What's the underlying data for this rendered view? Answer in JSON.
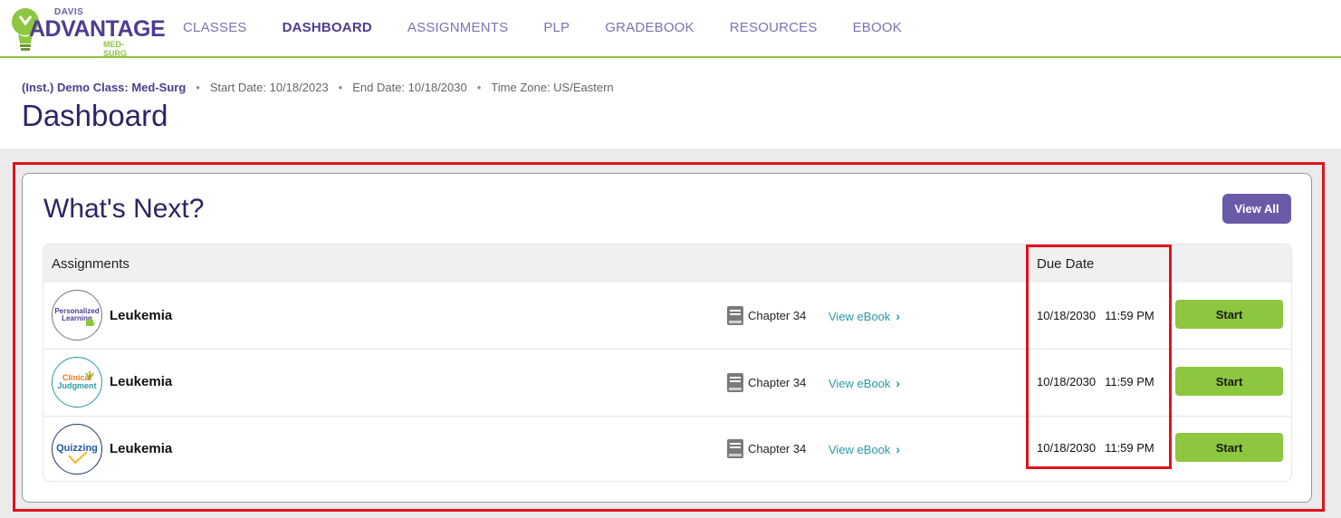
{
  "brand": {
    "line1": "DAVIS",
    "line2": "ADVANTAGE",
    "line3": "MED-SURG"
  },
  "nav": [
    {
      "label": "CLASSES",
      "active": false
    },
    {
      "label": "DASHBOARD",
      "active": true
    },
    {
      "label": "ASSIGNMENTS",
      "active": false
    },
    {
      "label": "PLP",
      "active": false
    },
    {
      "label": "GRADEBOOK",
      "active": false
    },
    {
      "label": "RESOURCES",
      "active": false
    },
    {
      "label": "EBOOK",
      "active": false
    }
  ],
  "meta": {
    "class_name": "(Inst.) Demo Class: Med-Surg",
    "start_date": "Start Date: 10/18/2023",
    "end_date": "End Date: 10/18/2030",
    "time_zone": "Time Zone: US/Eastern",
    "separator": "•"
  },
  "page_title": "Dashboard",
  "whats_next": {
    "title": "What's Next?",
    "view_all_label": "View All",
    "columns": {
      "assignments": "Assignments",
      "due_date": "Due Date"
    },
    "rows": [
      {
        "badge": [
          "Personalized",
          "Learning"
        ],
        "badge_icon": "puzzle-icon",
        "name": "Leukemia",
        "chapter": "Chapter 34",
        "ebook_label": "View eBook",
        "date": "10/18/2030",
        "time": "11:59 PM",
        "action": "Start"
      },
      {
        "badge": [
          "Clinical",
          "Judgment"
        ],
        "badge_icon": "scale-icon",
        "name": "Leukemia",
        "chapter": "Chapter 34",
        "ebook_label": "View eBook",
        "date": "10/18/2030",
        "time": "11:59 PM",
        "action": "Start"
      },
      {
        "badge": [
          "Quizzing"
        ],
        "badge_icon": "checkmark-icon",
        "name": "Leukemia",
        "chapter": "Chapter 34",
        "ebook_label": "View eBook",
        "date": "10/18/2030",
        "time": "11:59 PM",
        "action": "Start"
      }
    ]
  },
  "colors": {
    "primary": "#4d3d91",
    "accent_green": "#8dc63f",
    "link_teal": "#2a9aa1",
    "highlight_red": "#e0121c"
  }
}
